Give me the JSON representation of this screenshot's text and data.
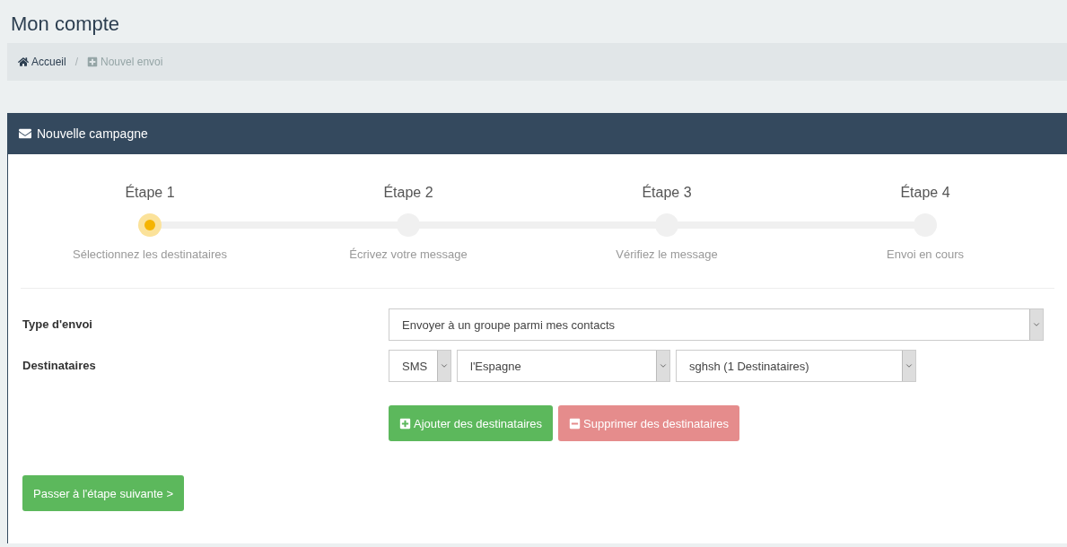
{
  "page_title": "Mon compte",
  "breadcrumb": {
    "separator": "/",
    "items": [
      {
        "label": "Accueil",
        "current": false
      },
      {
        "label": "Nouvel envoi",
        "current": true
      }
    ]
  },
  "panel": {
    "title": "Nouvelle campagne",
    "steps": [
      {
        "title": "Étape 1",
        "caption": "Sélectionnez les destinataires",
        "selected": true
      },
      {
        "title": "Étape 2",
        "caption": "Écrivez votre message",
        "selected": false
      },
      {
        "title": "Étape 3",
        "caption": "Vérifiez le message",
        "selected": false
      },
      {
        "title": "Étape 4",
        "caption": "Envoi en cours",
        "selected": false
      }
    ],
    "fields": [
      {
        "label": "Type d'envoi",
        "selects": [
          {
            "value": "Envoyer à un groupe parmi mes contacts"
          }
        ]
      },
      {
        "label": "Destinataires",
        "selects": [
          {
            "value": "SMS"
          },
          {
            "value": "l'Espagne"
          },
          {
            "value": "sghsh (1 Destinataires)"
          }
        ]
      }
    ],
    "actions": [
      {
        "label": "Ajouter des destinataires",
        "kind": "add"
      },
      {
        "label": "Supprimer des destinataires",
        "kind": "remove"
      }
    ],
    "next_button": "Passer à l'étape suivante >"
  }
}
